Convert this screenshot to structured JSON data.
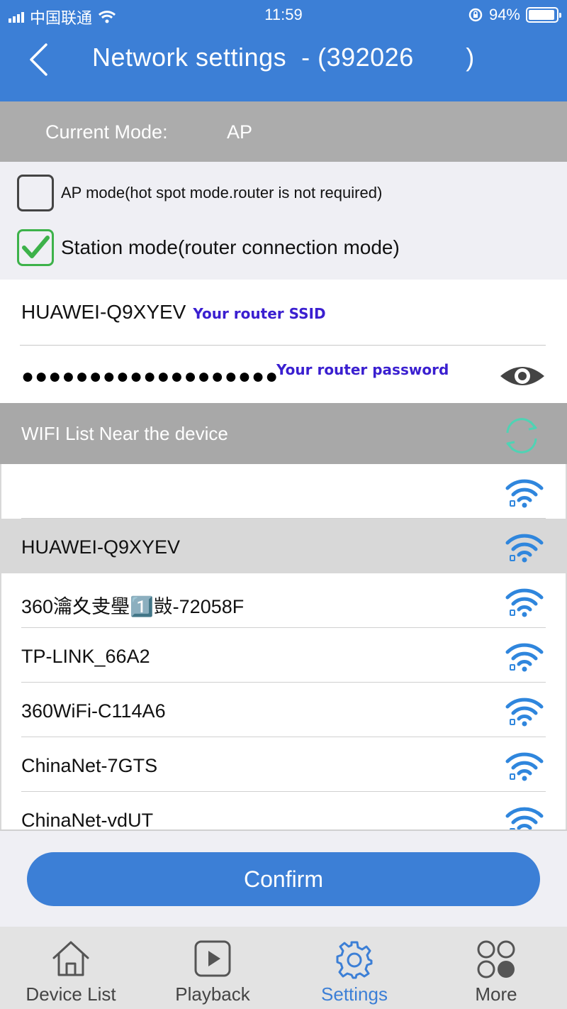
{
  "status_bar": {
    "carrier": "中国联通",
    "time": "11:59",
    "battery": "94%"
  },
  "header": {
    "title": "Network settings  - (392026       )"
  },
  "mode": {
    "label": "Current Mode:",
    "value": "AP"
  },
  "options": {
    "ap_mode": {
      "label": "AP mode(hot spot mode.router is not required)",
      "checked": false
    },
    "station_mode": {
      "label": "Station mode(router connection mode)",
      "checked": true
    }
  },
  "credentials": {
    "ssid": "HUAWEI-Q9XYEV",
    "ssid_hint": "Your router SSID",
    "password_masked": "●●●●●●●●●●●●●●●●●●●",
    "password_hint": "Your router password"
  },
  "wifi": {
    "header": "WIFI List Near the device",
    "networks": [
      {
        "name": "",
        "selected": false
      },
      {
        "name": "HUAWEI-Q9XYEV",
        "selected": true
      },
      {
        "name": "360瀹夊叏璺1️⃣敱-72058F",
        "selected": false
      },
      {
        "name": "TP-LINK_66A2",
        "selected": false
      },
      {
        "name": "360WiFi-C114A6",
        "selected": false
      },
      {
        "name": "ChinaNet-7GTS",
        "selected": false
      },
      {
        "name": "ChinaNet-vdUT",
        "selected": false
      }
    ]
  },
  "confirm_label": "Confirm",
  "tabs": [
    {
      "label": "Device List",
      "icon": "home-icon",
      "active": false
    },
    {
      "label": "Playback",
      "icon": "play-icon",
      "active": false
    },
    {
      "label": "Settings",
      "icon": "gear-icon",
      "active": true
    },
    {
      "label": "More",
      "icon": "more-icon",
      "active": false
    }
  ],
  "colors": {
    "primary": "#3c7fd6",
    "check": "#3db24a",
    "hint": "#3a1fd0",
    "refresh": "#4fd3b4"
  }
}
